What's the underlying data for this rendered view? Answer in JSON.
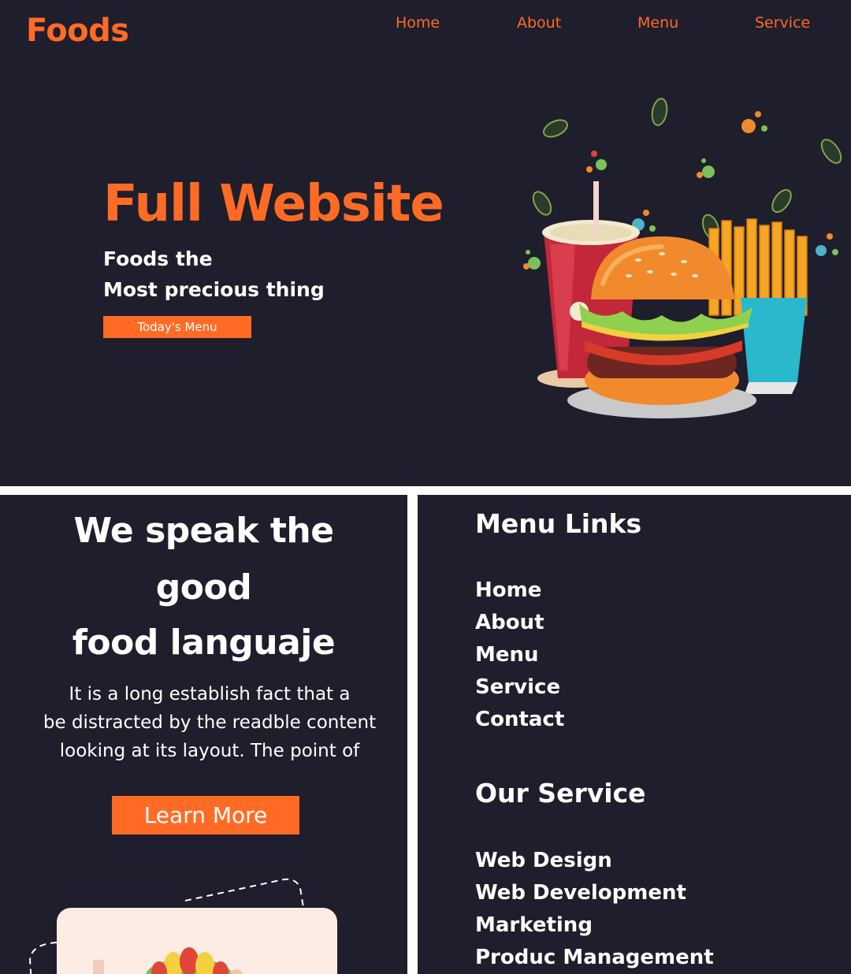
{
  "header": {
    "logo": "Foods",
    "nav": [
      "Home",
      "About",
      "Menu",
      "Service"
    ]
  },
  "hero": {
    "title": "Full Website",
    "subtitle_line1": "Foods the",
    "subtitle_line2": "Most precious thing",
    "button_label": "Today's Menu",
    "illustration": "burger-drink-fries-icon"
  },
  "about": {
    "title_line1": "We speak the",
    "title_line2": "good",
    "title_line3": "food languaje",
    "text_line1": "It is a long establish fact that a",
    "text_line2": "be distracted by the readble content",
    "text_line3": "looking at its layout. The point of",
    "button_label": "Learn More"
  },
  "footer": {
    "menu_heading": "Menu Links",
    "menu_links": [
      "Home",
      "About",
      "Menu",
      "Service",
      "Contact"
    ],
    "service_heading": "Our Service",
    "service_links": [
      "Web Design",
      "Web Development",
      "Marketing",
      "Produc Management"
    ]
  },
  "colors": {
    "background": "#1f1e2c",
    "accent": "#ff6b25",
    "text": "#ffffff"
  }
}
